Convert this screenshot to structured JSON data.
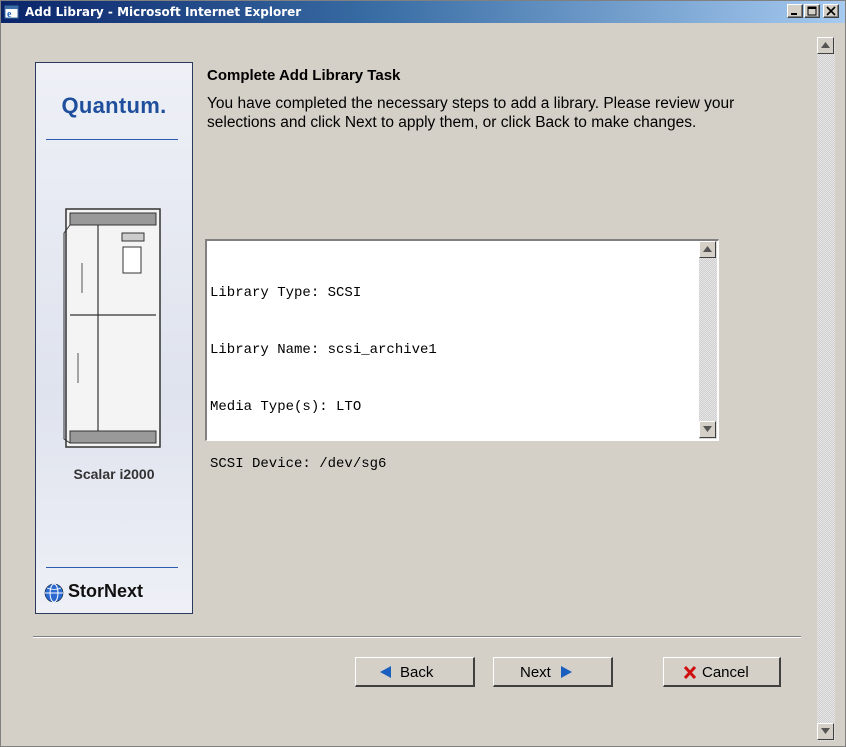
{
  "window": {
    "title": "Add Library - Microsoft Internet Explorer"
  },
  "brand": {
    "vendor_logo": "Quantum.",
    "model": "Scalar i2000",
    "product_logo": "StorNext"
  },
  "wizard": {
    "heading": "Complete Add Library Task",
    "description": "You have completed the necessary steps to add a library. Please review your selections and click Next to apply them, or click Back to make changes.",
    "summary_lines": [
      "Library Type: SCSI",
      "Library Name: scsi_archive1",
      "Media Type(s): LTO",
      "SCSI Device: /dev/sg6"
    ]
  },
  "buttons": {
    "back": "Back",
    "next": "Next",
    "cancel": "Cancel"
  },
  "icons": {
    "title": "ie-icon",
    "back": "left-arrow-icon",
    "next": "right-arrow-icon",
    "cancel": "red-x-icon"
  },
  "colors": {
    "titlebar_start": "#0a246a",
    "titlebar_end": "#a6caf0",
    "quantum_blue": "#1f4e9c",
    "arrow_blue": "#1a5fc0",
    "cancel_red": "#d01010"
  }
}
